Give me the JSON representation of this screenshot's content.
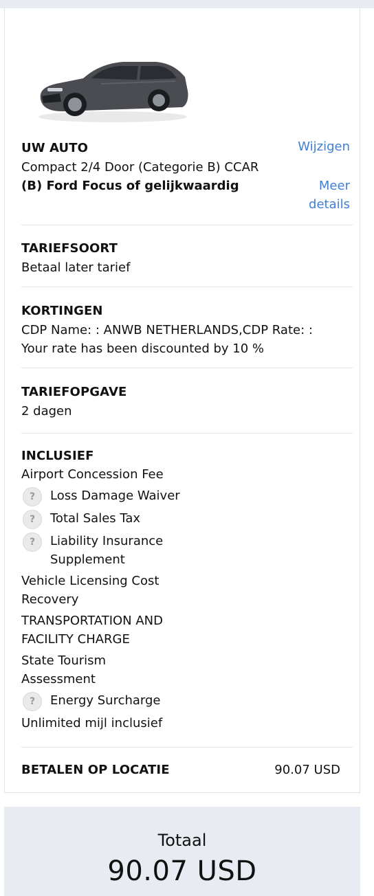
{
  "car": {
    "section_title": "UW AUTO",
    "change_link": "Wijzigen",
    "category": "Compact 2/4 Door (Categorie B) CCAR",
    "model": "(B) Ford Focus of gelijkwaardig",
    "details_link_line1": "Meer",
    "details_link_line2": "details",
    "image_color": "#4a4c52"
  },
  "rate_type": {
    "title": "TARIEFSOORT",
    "value": "Betaal later tarief"
  },
  "discounts": {
    "title": "KORTINGEN",
    "line1": "CDP Name: : ANWB NETHERLANDS,CDP Rate: :",
    "line2": "Your rate has been discounted by 10 %"
  },
  "rate_quote": {
    "title": "TARIEFOPGAVE",
    "value": "2 dagen"
  },
  "included": {
    "title": "INCLUSIEF",
    "items": [
      {
        "label": "Airport Concession Fee"
      },
      {
        "label": "Loss Damage Waiver",
        "info_icon": "question-icon"
      },
      {
        "label": "Total Sales Tax",
        "info_icon": "question-icon"
      },
      {
        "label_line1": "Liability Insurance",
        "label_line2": "Supplement",
        "info_icon": "question-icon"
      },
      {
        "label_line1": "Vehicle Licensing Cost",
        "label_line2": "Recovery"
      },
      {
        "label_line1": "TRANSPORTATION AND",
        "label_line2": "FACILITY CHARGE"
      },
      {
        "label_line1": "State Tourism",
        "label_line2": "Assessment"
      },
      {
        "label": "Energy Surcharge",
        "info_icon": "question-icon"
      },
      {
        "label": "Unlimited mijl inclusief"
      }
    ]
  },
  "pay_at_location": {
    "label": "BETALEN OP LOCATIE",
    "amount": "90.07 USD"
  },
  "total": {
    "label": "Totaal",
    "amount": "90.07 USD"
  },
  "colors": {
    "link": "#3f7fd6",
    "panel_bg": "#e8ebf2",
    "divider": "#e3e5e9"
  }
}
